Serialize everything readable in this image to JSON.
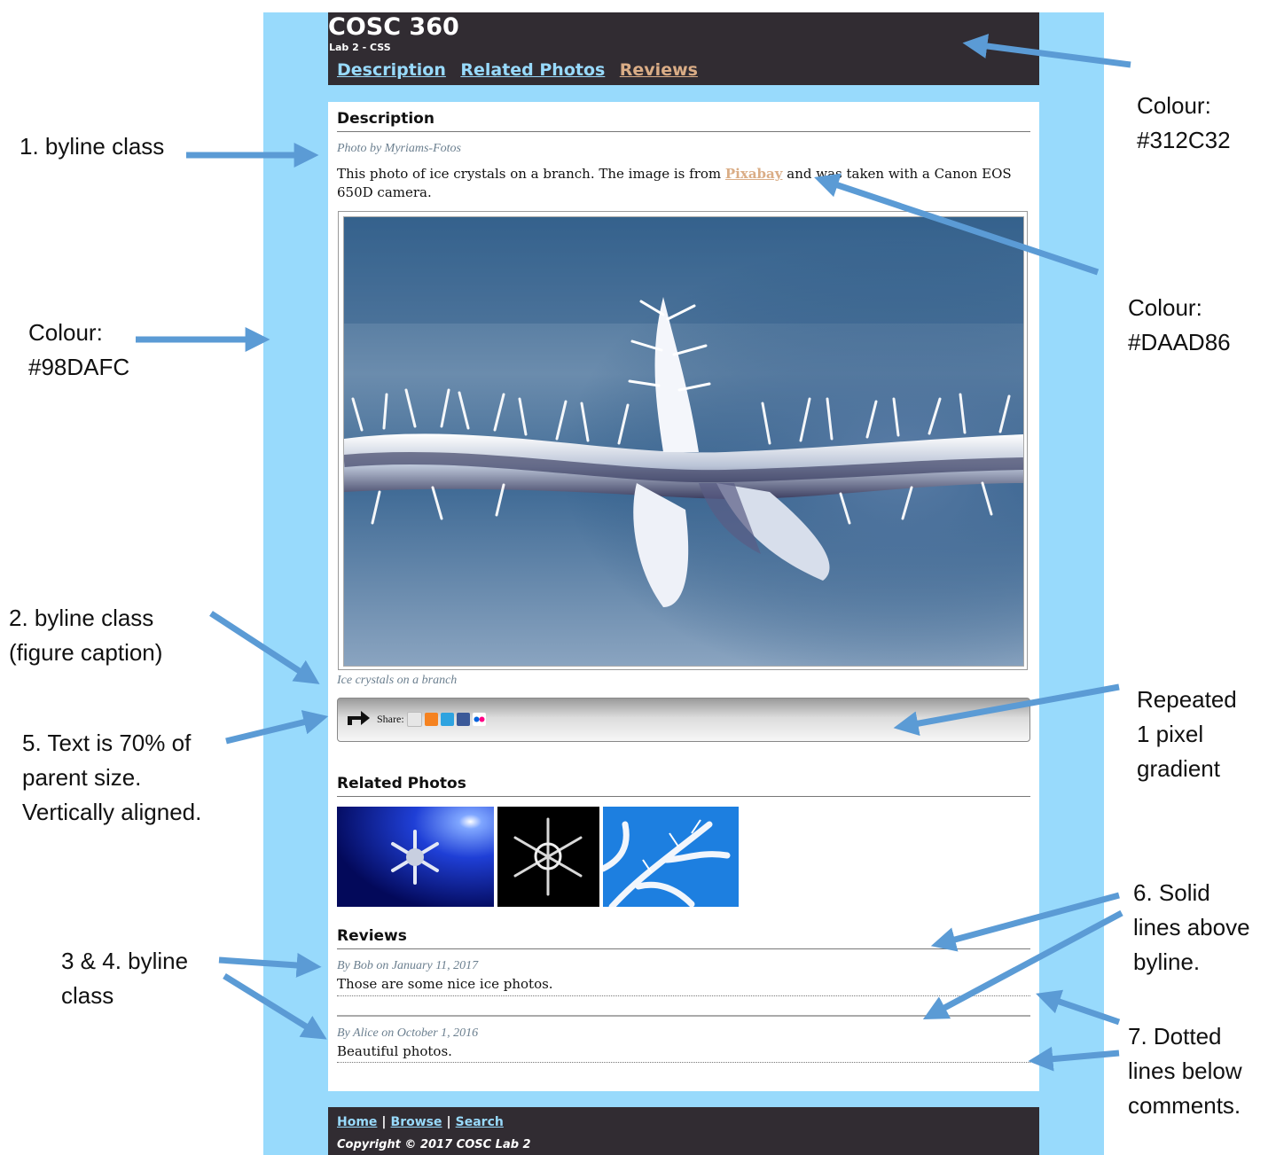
{
  "page": {
    "site_title": "COSC 360",
    "site_subtitle": "Lab 2 - CSS",
    "nav": [
      "Description",
      "Related Photos",
      "Reviews"
    ],
    "description": {
      "heading": "Description",
      "byline": "Photo by Myriams-Fotos",
      "text_before_link": "This photo of ice crystals on a branch. The image is from ",
      "link": "Pixabay",
      "text_after_link": " and was taken with a Canon EOS 650D camera.",
      "figure_caption": "Ice crystals on a branch",
      "share_label": "Share:",
      "share_icons": [
        "email-icon",
        "rss-icon",
        "twitter-icon",
        "facebook-icon",
        "flickr-icon"
      ]
    },
    "related": {
      "heading": "Related Photos"
    },
    "reviews": {
      "heading": "Reviews",
      "items": [
        {
          "byline": "By Bob on January 11, 2017",
          "text": "Those are some nice ice photos."
        },
        {
          "byline": "By Alice on October 1, 2016",
          "text": "Beautiful photos."
        }
      ]
    },
    "footer": {
      "links": [
        "Home",
        "Browse",
        "Search"
      ],
      "separator": "|",
      "copyright": "Copyright © 2017 COSC Lab 2"
    }
  },
  "annotations": {
    "header_colour": "Colour:\n#312C32",
    "link_colour": "Colour:\n#DAAD86",
    "side_colour": "Colour:\n#98DAFC",
    "byline_1": "1. byline class",
    "byline_2": "2. byline class\n(figure caption)",
    "share_text": "5. Text is 70% of\nparent size.\nVertically aligned.",
    "gradient": "Repeated\n1 pixel\ngradient",
    "byline_34": "3 & 4. byline\nclass",
    "solid_lines": "6. Solid\nlines above\nbyline.",
    "dotted_lines": "7. Dotted\nlines below\ncomments."
  },
  "colors": {
    "side": "#98DAFC",
    "header": "#312C32",
    "accent": "#DAAD86",
    "arrow": "#5B9BD5"
  }
}
